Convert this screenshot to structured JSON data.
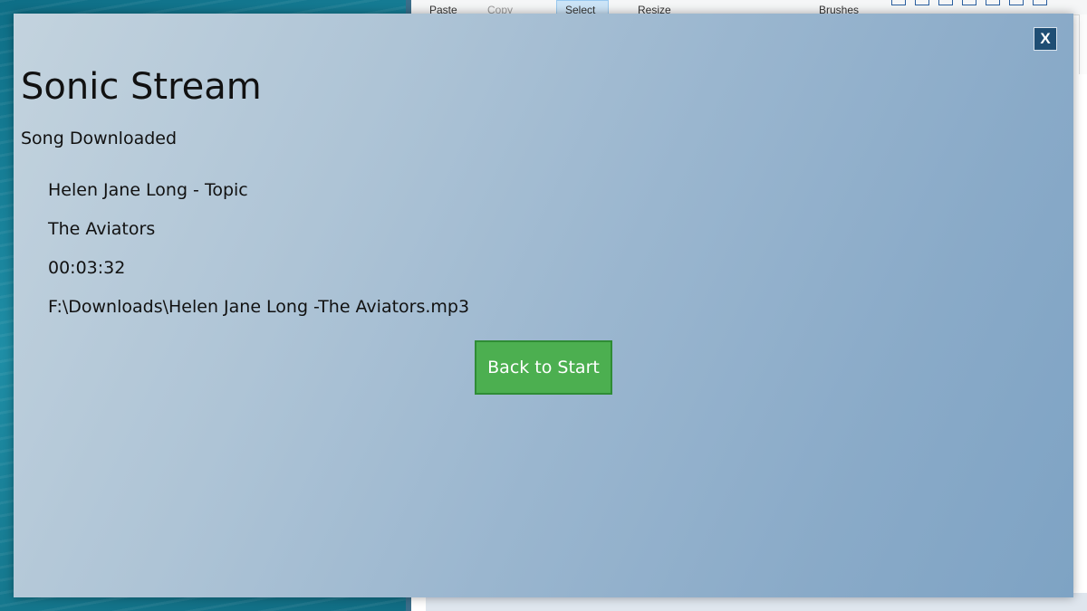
{
  "app": {
    "title": "Sonic Stream",
    "status": "Song Downloaded",
    "close_label": "X",
    "back_button_label": "Back to Start"
  },
  "song": {
    "channel": "Helen Jane Long - Topic",
    "title": "The Aviators",
    "duration": "00:03:32",
    "file_path": "F:\\Downloads\\Helen Jane Long -The Aviators.mp3"
  },
  "background_paint": {
    "ribbon_items": [
      "Paste",
      "Copy",
      "Select",
      "Resize",
      "Brushes"
    ]
  },
  "colors": {
    "accent_button": "#4caf50",
    "close_button": "#1f4e74"
  }
}
